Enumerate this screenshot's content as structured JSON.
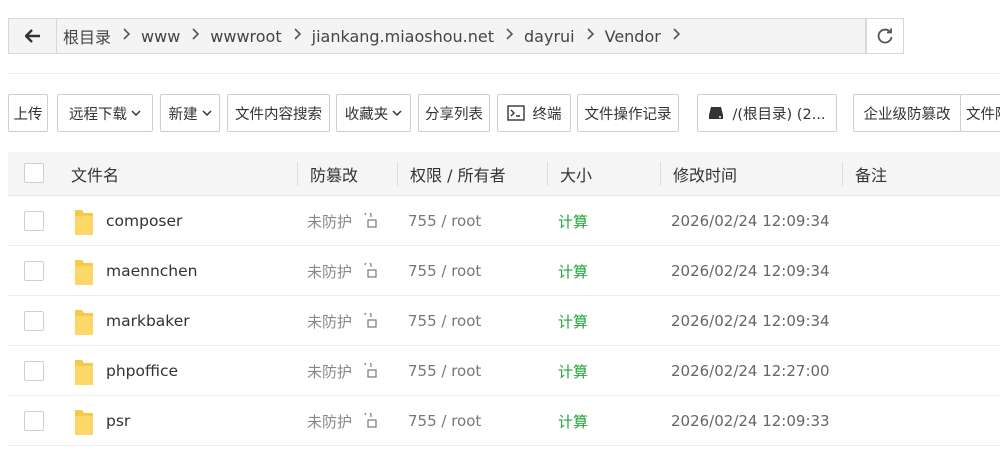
{
  "breadcrumb": [
    "根目录",
    "www",
    "wwwroot",
    "jiankang.miaoshou.net",
    "dayrui",
    "Vendor"
  ],
  "toolbar": {
    "upload": "上传",
    "remote_download": "远程下载",
    "new": "新建",
    "content_search": "文件内容搜索",
    "favorites": "收藏夹",
    "share_list": "分享列表",
    "terminal": "终端",
    "op_log": "文件操作记录",
    "disk": "/(根目录) (2...",
    "enterprise_tamper": "企业级防篡改",
    "file_more": "文件降"
  },
  "columns": {
    "name": "文件名",
    "tamper": "防篡改",
    "perm": "权限 / 所有者",
    "size": "大小",
    "mtime": "修改时间",
    "note": "备注"
  },
  "rows": [
    {
      "name": "composer",
      "protect": "未防护",
      "perm": "755 / root",
      "size": "计算",
      "mtime": "2026/02/24 12:09:34"
    },
    {
      "name": "maennchen",
      "protect": "未防护",
      "perm": "755 / root",
      "size": "计算",
      "mtime": "2026/02/24 12:09:34"
    },
    {
      "name": "markbaker",
      "protect": "未防护",
      "perm": "755 / root",
      "size": "计算",
      "mtime": "2026/02/24 12:09:34"
    },
    {
      "name": "phpoffice",
      "protect": "未防护",
      "perm": "755 / root",
      "size": "计算",
      "mtime": "2026/02/24 12:27:00"
    },
    {
      "name": "psr",
      "protect": "未防护",
      "perm": "755 / root",
      "size": "计算",
      "mtime": "2026/02/24 12:09:33"
    }
  ],
  "icons": {
    "back": "arrow-left-icon",
    "refresh": "refresh-icon",
    "caret": "chevron-down-icon",
    "terminal": "terminal-icon",
    "disk": "hard-drive-icon",
    "folder": "folder-icon",
    "lock": "unlock-icon"
  },
  "colors": {
    "accent_green": "#20a53a",
    "folder_yellow": "#f7c948",
    "header_bg": "#f5f5f5"
  }
}
